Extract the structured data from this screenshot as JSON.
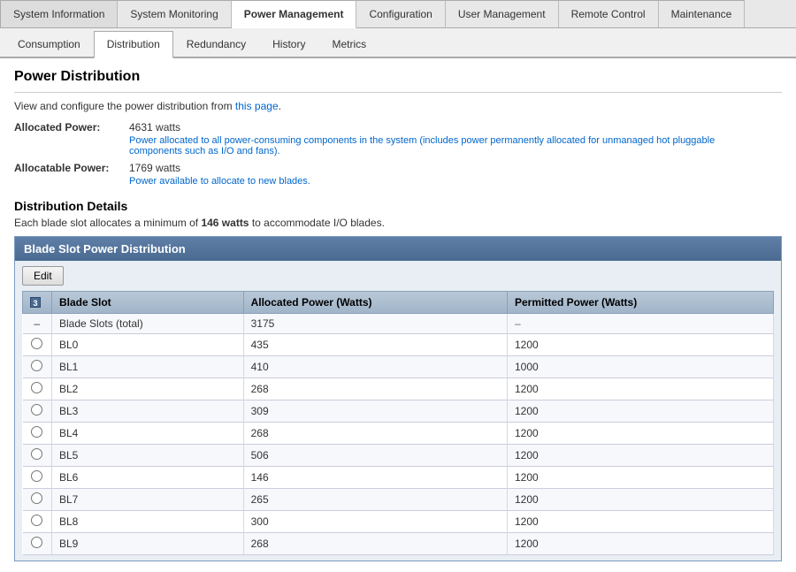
{
  "topNav": {
    "items": [
      {
        "label": "System Information",
        "id": "system-information",
        "active": false
      },
      {
        "label": "System Monitoring",
        "id": "system-monitoring",
        "active": false
      },
      {
        "label": "Power Management",
        "id": "power-management",
        "active": true
      },
      {
        "label": "Configuration",
        "id": "configuration",
        "active": false
      },
      {
        "label": "User Management",
        "id": "user-management",
        "active": false
      },
      {
        "label": "Remote Control",
        "id": "remote-control",
        "active": false
      },
      {
        "label": "Maintenance",
        "id": "maintenance",
        "active": false
      }
    ]
  },
  "subNav": {
    "items": [
      {
        "label": "Consumption",
        "id": "consumption",
        "active": false
      },
      {
        "label": "Distribution",
        "id": "distribution",
        "active": true
      },
      {
        "label": "Redundancy",
        "id": "redundancy",
        "active": false
      },
      {
        "label": "History",
        "id": "history",
        "active": false
      },
      {
        "label": "Metrics",
        "id": "metrics",
        "active": false
      }
    ]
  },
  "page": {
    "title": "Power Distribution",
    "description": "View and configure the power distribution from this page.",
    "allocatedPower": {
      "label": "Allocated Power:",
      "value": "4631 watts",
      "note": "Power allocated to all power-consuming components in the system (includes power permanently allocated for unmanaged hot pluggable components such as I/O and fans)."
    },
    "allocatablePower": {
      "label": "Allocatable Power:",
      "value": "1769 watts",
      "note": "Power available to allocate to new blades."
    },
    "detailsTitle": "Distribution Details",
    "detailsDesc1": "Each blade slot allocates a minimum of",
    "detailsMinWatts": "146 watts",
    "detailsDesc2": "to accommodate I/O blades."
  },
  "panel": {
    "title": "Blade Slot Power Distribution",
    "editButton": "Edit",
    "table": {
      "columns": [
        {
          "label": "Blade Slot",
          "id": "blade-slot"
        },
        {
          "label": "Allocated Power (Watts)",
          "id": "allocated-power"
        },
        {
          "label": "Permitted Power (Watts)",
          "id": "permitted-power"
        }
      ],
      "rows": [
        {
          "radio": false,
          "slot": "Blade Slots (total)",
          "allocated": "3175",
          "permitted": "–",
          "isDash": true
        },
        {
          "radio": true,
          "slot": "BL0",
          "allocated": "435",
          "permitted": "1200",
          "isDash": false
        },
        {
          "radio": true,
          "slot": "BL1",
          "allocated": "410",
          "permitted": "1000",
          "isDash": false
        },
        {
          "radio": true,
          "slot": "BL2",
          "allocated": "268",
          "permitted": "1200",
          "isDash": false
        },
        {
          "radio": true,
          "slot": "BL3",
          "allocated": "309",
          "permitted": "1200",
          "isDash": false
        },
        {
          "radio": true,
          "slot": "BL4",
          "allocated": "268",
          "permitted": "1200",
          "isDash": false
        },
        {
          "radio": true,
          "slot": "BL5",
          "allocated": "506",
          "permitted": "1200",
          "isDash": false
        },
        {
          "radio": true,
          "slot": "BL6",
          "allocated": "146",
          "permitted": "1200",
          "isDash": false
        },
        {
          "radio": true,
          "slot": "BL7",
          "allocated": "265",
          "permitted": "1200",
          "isDash": false
        },
        {
          "radio": true,
          "slot": "BL8",
          "allocated": "300",
          "permitted": "1200",
          "isDash": false
        },
        {
          "radio": true,
          "slot": "BL9",
          "allocated": "268",
          "permitted": "1200",
          "isDash": false
        }
      ]
    }
  }
}
